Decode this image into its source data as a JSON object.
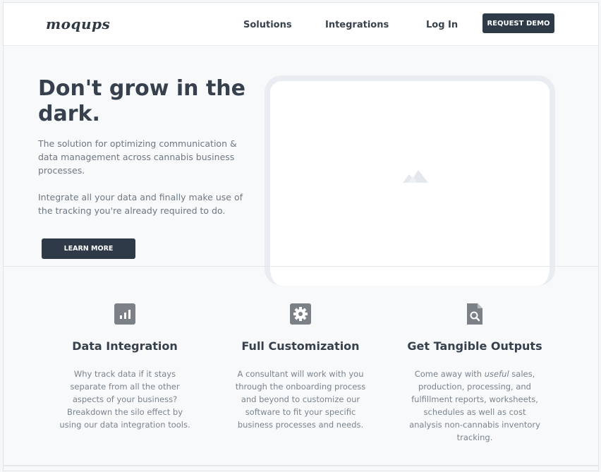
{
  "header": {
    "logo": "moqups",
    "nav": [
      "Solutions",
      "Integrations",
      "Log In"
    ],
    "cta": "REQUEST DEMO"
  },
  "hero": {
    "title": "Don't grow in the dark.",
    "paragraph1": "The solution for optimizing communication & data management across cannabis business processes.",
    "paragraph2": "Integrate all your data and finally make use of the tracking you're already required to do.",
    "button": "LEARN MORE",
    "image_icon": "image-placeholder-icon"
  },
  "features": [
    {
      "icon": "bar-chart-icon",
      "title": "Data Integration",
      "text": "Why track data if it stays separate from all the other aspects of your business? Breakdown the silo effect by using our data integration tools."
    },
    {
      "icon": "gear-icon",
      "title": "Full Customization",
      "text": "A consultant will work with you through the onboarding process and beyond to customize our software to fit your specific business processes and needs."
    },
    {
      "icon": "file-search-icon",
      "title": "Get Tangible Outputs",
      "text_before": "Come away with ",
      "text_emphasis": "useful",
      "text_after": " sales, production, processing, and fulfillment reports, worksheets, schedules as well as cost analysis non-cannabis inventory tracking."
    }
  ],
  "colors": {
    "dark_button": "#2f3a48",
    "heading": "#36414d",
    "body_text": "#6e7883",
    "icon": "#7b8187",
    "placeholder": "#e9edf2"
  }
}
